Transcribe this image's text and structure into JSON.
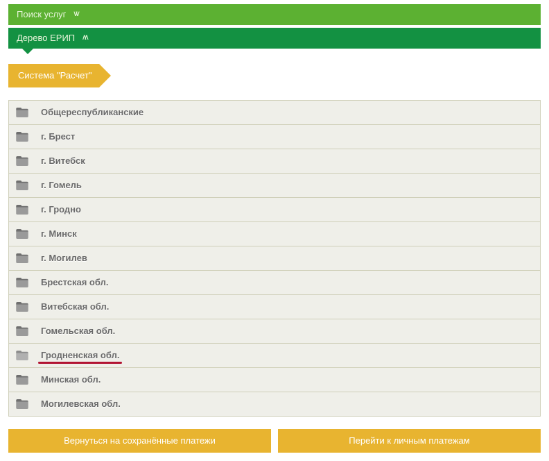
{
  "header": {
    "search_label": "Поиск услуг",
    "tree_label": "Дерево ЕРИП"
  },
  "breadcrumb": {
    "current": "Система \"Расчет\""
  },
  "folders": [
    {
      "label": "Общереспубликанские",
      "highlight": false
    },
    {
      "label": "г. Брест",
      "highlight": false
    },
    {
      "label": "г. Витебск",
      "highlight": false
    },
    {
      "label": "г. Гомель",
      "highlight": false
    },
    {
      "label": "г. Гродно",
      "highlight": false
    },
    {
      "label": "г. Минск",
      "highlight": false
    },
    {
      "label": "г. Могилев",
      "highlight": false
    },
    {
      "label": "Брестская обл.",
      "highlight": false
    },
    {
      "label": "Витебская обл.",
      "highlight": false
    },
    {
      "label": "Гомельская обл.",
      "highlight": false
    },
    {
      "label": "Гродненская обл.",
      "highlight": true
    },
    {
      "label": "Минская обл.",
      "highlight": false
    },
    {
      "label": "Могилевская обл.",
      "highlight": false
    }
  ],
  "buttons": {
    "back": "Вернуться на сохранённые платежи",
    "personal": "Перейти к личным платежам"
  }
}
